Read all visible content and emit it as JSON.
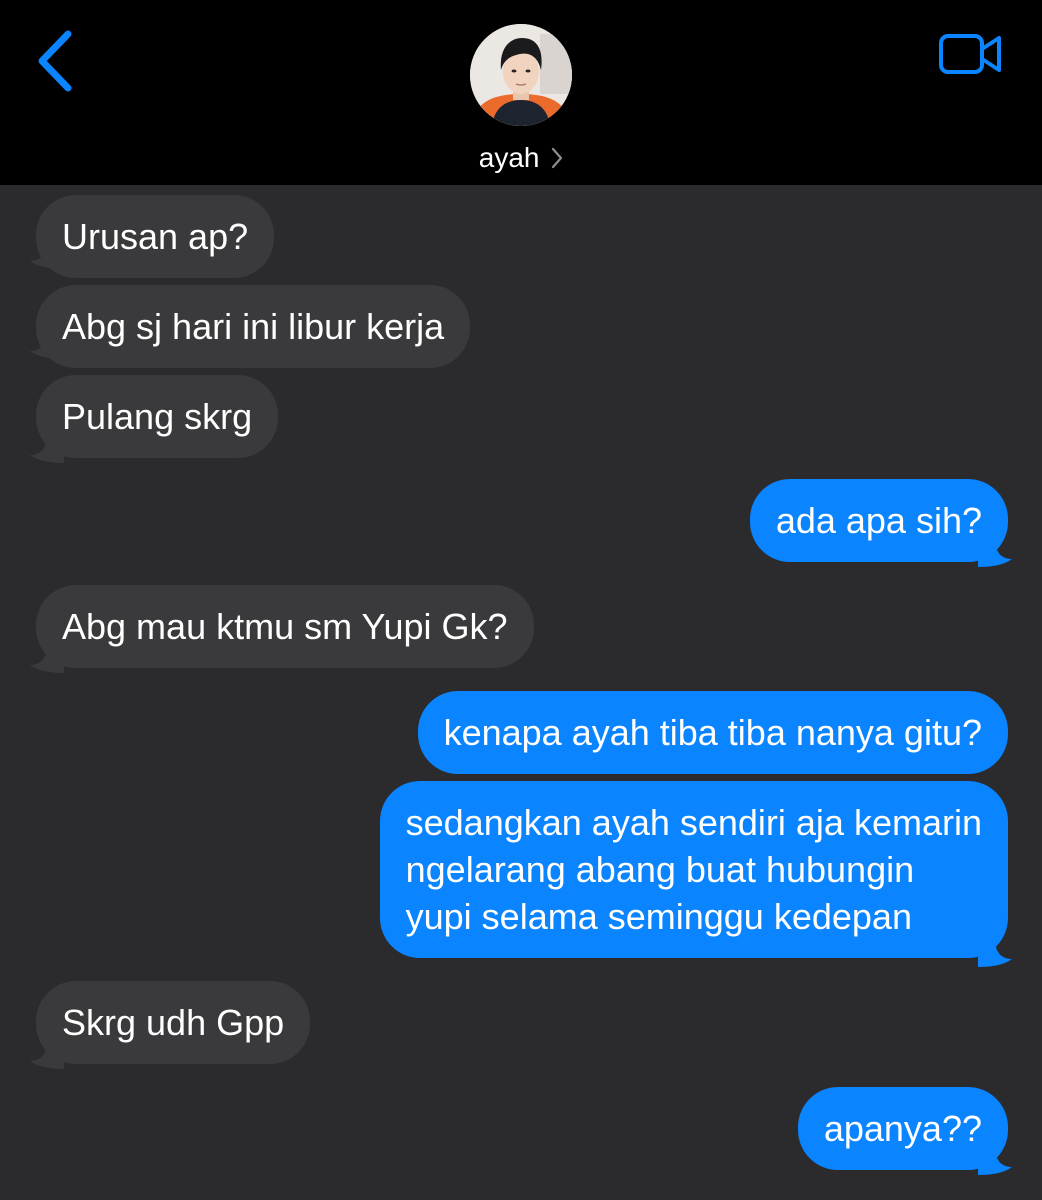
{
  "header": {
    "back_icon": "chevron-left-icon",
    "contact_name": "ayah",
    "contact_chevron_icon": "chevron-right-icon",
    "video_icon": "video-camera-icon",
    "accent_color": "#0a84ff"
  },
  "messages": [
    {
      "direction": "incoming",
      "text": "Urusan ap?"
    },
    {
      "direction": "incoming",
      "text": "Abg sj hari ini libur kerja"
    },
    {
      "direction": "incoming",
      "text": "Pulang skrg"
    },
    {
      "direction": "outgoing",
      "text": "ada apa sih?"
    },
    {
      "direction": "incoming",
      "text": "Abg mau ktmu sm Yupi Gk?"
    },
    {
      "direction": "outgoing",
      "text": "kenapa ayah tiba tiba nanya gitu?"
    },
    {
      "direction": "outgoing",
      "lines": [
        "sedangkan ayah sendiri aja kemarin",
        "ngelarang abang buat hubungin",
        "yupi selama seminggu kedepan"
      ]
    },
    {
      "direction": "incoming",
      "text": "Skrg udh Gpp"
    },
    {
      "direction": "outgoing",
      "text": "apanya??"
    }
  ],
  "colors": {
    "incoming_bubble": "#3a3a3c",
    "outgoing_bubble": "#0a84ff",
    "thread_background": "#2b2b2d",
    "header_background": "#000000"
  }
}
